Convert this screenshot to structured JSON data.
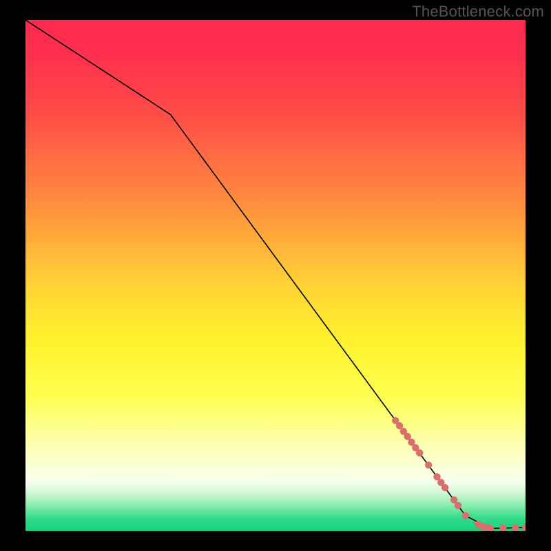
{
  "watermark": "TheBottleneck.com",
  "chart_data": {
    "type": "line",
    "title": "",
    "xlabel": "",
    "ylabel": "",
    "xlim": [
      0,
      100
    ],
    "ylim": [
      0,
      100
    ],
    "background_gradient": {
      "stops": [
        {
          "offset": 0.0,
          "color": "#ff2a4d"
        },
        {
          "offset": 0.06,
          "color": "#ff2e4e"
        },
        {
          "offset": 0.18,
          "color": "#ff4b47"
        },
        {
          "offset": 0.35,
          "color": "#ff8a3f"
        },
        {
          "offset": 0.52,
          "color": "#ffd335"
        },
        {
          "offset": 0.63,
          "color": "#fff22e"
        },
        {
          "offset": 0.74,
          "color": "#feff52"
        },
        {
          "offset": 0.82,
          "color": "#fdffa6"
        },
        {
          "offset": 0.885,
          "color": "#fbffe0"
        },
        {
          "offset": 0.905,
          "color": "#f4fdee"
        },
        {
          "offset": 0.93,
          "color": "#c7f5cf"
        },
        {
          "offset": 0.955,
          "color": "#79e9a7"
        },
        {
          "offset": 0.975,
          "color": "#34db8a"
        },
        {
          "offset": 1.0,
          "color": "#16d07d"
        }
      ]
    },
    "series": [
      {
        "name": "curve",
        "stroke": "#000000",
        "stroke_width": 1.6,
        "points": [
          {
            "x": 0.0,
            "y": 100.0
          },
          {
            "x": 29.0,
            "y": 81.5
          },
          {
            "x": 88.0,
            "y": 3.0
          },
          {
            "x": 93.0,
            "y": 0.5
          },
          {
            "x": 100.0,
            "y": 0.7
          }
        ]
      }
    ],
    "markers": {
      "name": "highlight-dots",
      "color": "#d86f6a",
      "radius": 5.2,
      "points": [
        {
          "x": 74.0,
          "y": 21.6
        },
        {
          "x": 74.8,
          "y": 20.6
        },
        {
          "x": 75.6,
          "y": 19.5
        },
        {
          "x": 76.4,
          "y": 18.5
        },
        {
          "x": 77.2,
          "y": 17.4
        },
        {
          "x": 78.0,
          "y": 16.3
        },
        {
          "x": 78.8,
          "y": 15.3
        },
        {
          "x": 80.6,
          "y": 12.9
        },
        {
          "x": 82.3,
          "y": 10.6
        },
        {
          "x": 83.1,
          "y": 9.5
        },
        {
          "x": 83.9,
          "y": 8.5
        },
        {
          "x": 85.7,
          "y": 6.1
        },
        {
          "x": 86.5,
          "y": 5.0
        },
        {
          "x": 88.0,
          "y": 3.0
        },
        {
          "x": 90.5,
          "y": 1.3
        },
        {
          "x": 91.3,
          "y": 0.95
        },
        {
          "x": 92.1,
          "y": 0.7
        },
        {
          "x": 93.0,
          "y": 0.5
        },
        {
          "x": 95.5,
          "y": 0.6
        },
        {
          "x": 98.0,
          "y": 0.65
        },
        {
          "x": 100.0,
          "y": 0.7
        }
      ]
    }
  }
}
